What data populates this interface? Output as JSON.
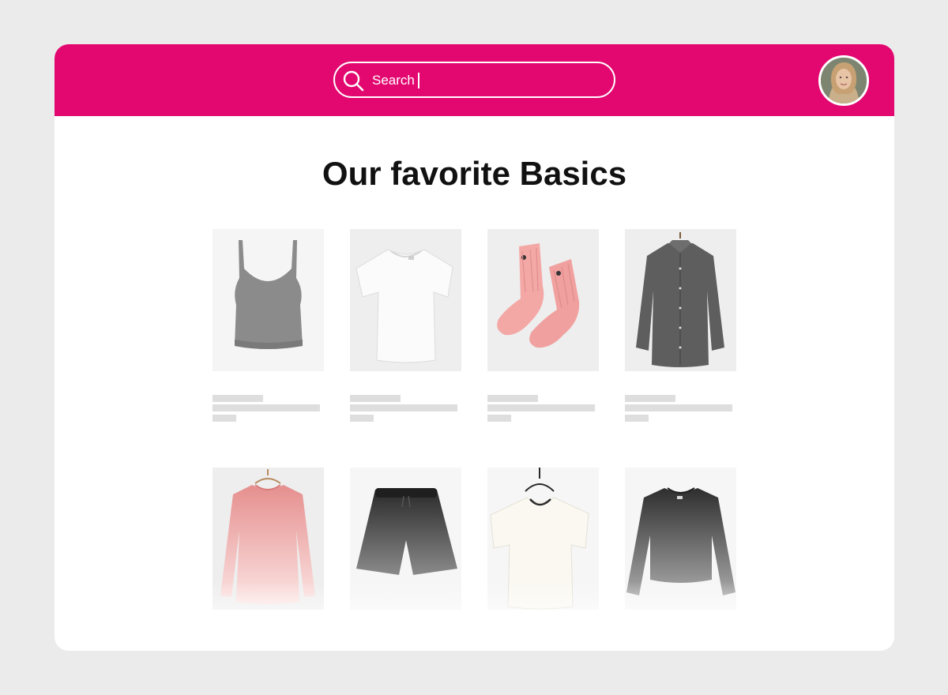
{
  "header": {
    "brand_color": "#e30870",
    "search": {
      "value": "Search",
      "icon": "search-icon"
    },
    "avatar": {
      "icon": "user-avatar"
    }
  },
  "main": {
    "title": "Our favorite Basics",
    "products": [
      {
        "item": "gray-tank-top-icon",
        "colors": [
          "#8a8a8a"
        ]
      },
      {
        "item": "white-t-shirt-icon",
        "colors": [
          "#f7f7f7"
        ]
      },
      {
        "item": "pink-socks-icon",
        "colors": [
          "#f2a5a5"
        ]
      },
      {
        "item": "gray-button-shirt-icon",
        "colors": [
          "#5c5c5c"
        ]
      },
      {
        "item": "pink-long-sleeve-icon",
        "colors": [
          "#e7908f"
        ]
      },
      {
        "item": "black-shorts-icon",
        "colors": [
          "#2e2e2e"
        ]
      },
      {
        "item": "white-t-shirt-hanger-icon",
        "colors": [
          "#f8f6ef"
        ]
      },
      {
        "item": "black-long-sleeve-icon",
        "colors": [
          "#3a3a3a"
        ]
      }
    ]
  }
}
